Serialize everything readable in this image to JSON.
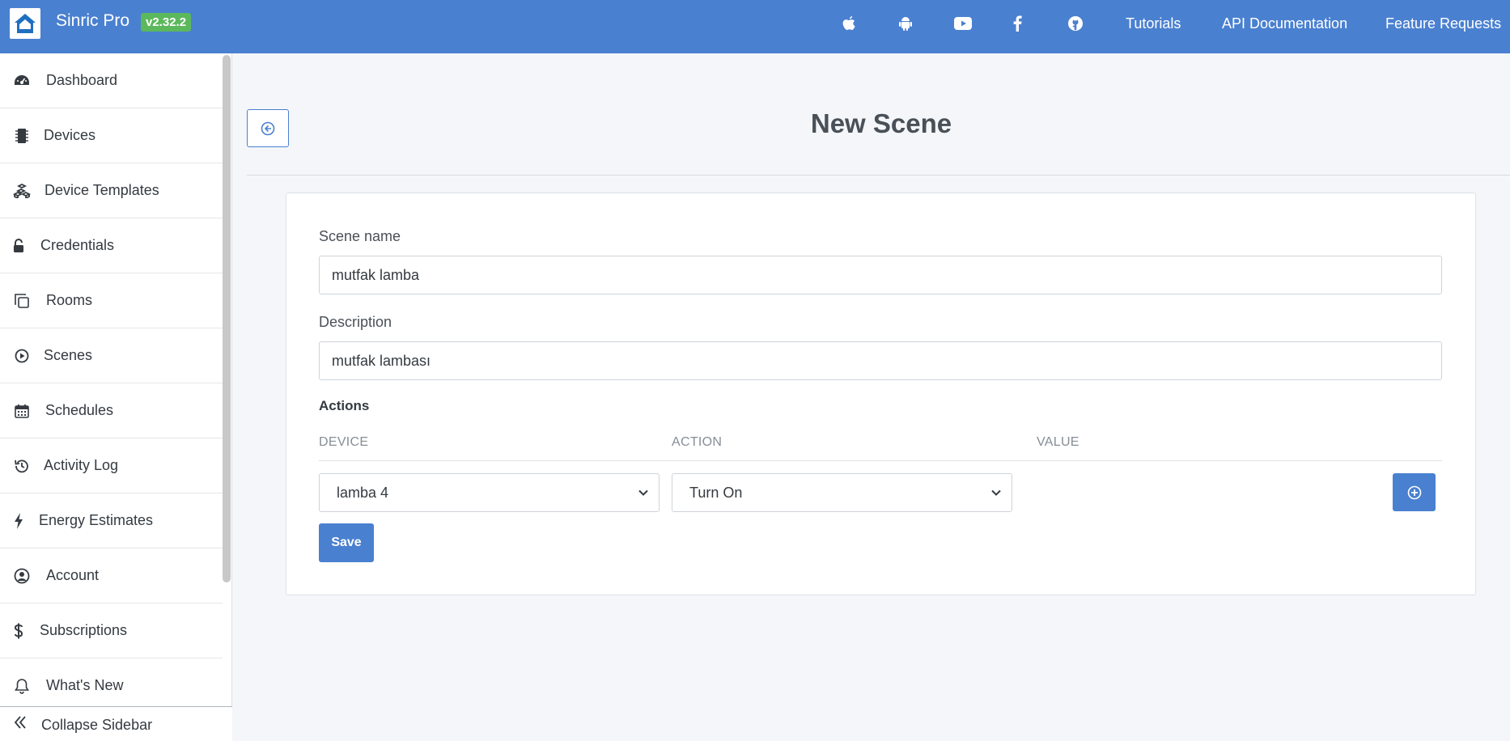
{
  "header": {
    "brand": "Sinric Pro",
    "version": "v2.32.2",
    "icons": [
      "apple-icon",
      "android-icon",
      "youtube-icon",
      "facebook-icon",
      "github-icon"
    ],
    "links": [
      "Tutorials",
      "API Documentation",
      "Feature Requests"
    ]
  },
  "sidebar": {
    "items": [
      {
        "label": "Dashboard",
        "icon": "dashboard-icon"
      },
      {
        "label": "Devices",
        "icon": "microchip-icon"
      },
      {
        "label": "Device Templates",
        "icon": "cubes-icon"
      },
      {
        "label": "Credentials",
        "icon": "unlock-icon"
      },
      {
        "label": "Rooms",
        "icon": "copy-icon"
      },
      {
        "label": "Scenes",
        "icon": "play-circle-icon"
      },
      {
        "label": "Schedules",
        "icon": "calendar-icon"
      },
      {
        "label": "Activity Log",
        "icon": "history-icon"
      },
      {
        "label": "Energy Estimates",
        "icon": "bolt-icon"
      },
      {
        "label": "Account",
        "icon": "user-circle-icon"
      },
      {
        "label": "Subscriptions",
        "icon": "dollar-icon"
      },
      {
        "label": "What's New",
        "icon": "bell-icon"
      }
    ],
    "collapse_label": "Collapse Sidebar"
  },
  "page": {
    "title": "New Scene"
  },
  "form": {
    "scene_name_label": "Scene name",
    "scene_name_value": "mutfak lamba",
    "description_label": "Description",
    "description_value": "mutfak lambası",
    "actions_label": "Actions",
    "columns": [
      "DEVICE",
      "ACTION",
      "VALUE"
    ],
    "row": {
      "device": "lamba 4",
      "action": "Turn On"
    },
    "save_label": "Save"
  },
  "colors": {
    "accent": "#4a80d0",
    "version_badge": "#5cb85c"
  }
}
